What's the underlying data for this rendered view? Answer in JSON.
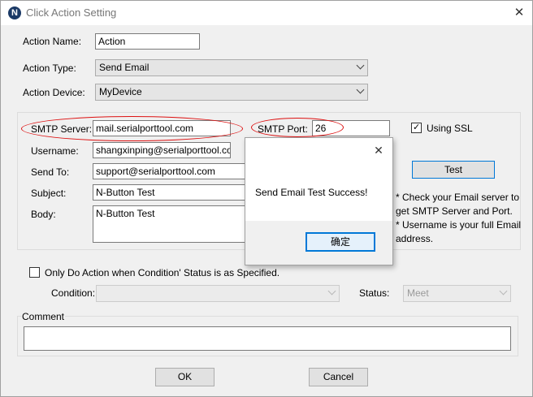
{
  "window": {
    "title": "Click Action Setting",
    "app_icon_letter": "N",
    "close_glyph": "✕"
  },
  "action": {
    "name_label": "Action Name:",
    "name_value": "Action",
    "type_label": "Action Type:",
    "type_value": "Send Email",
    "device_label": "Action Device:",
    "device_value": "MyDevice"
  },
  "email": {
    "smtp_server_label": "SMTP Server:",
    "smtp_server_value": "mail.serialporttool.com",
    "smtp_port_label": "SMTP Port:",
    "smtp_port_value": "26",
    "ssl_label": "Using SSL",
    "ssl_checked": true,
    "check_glyph": "✓",
    "username_label": "Username:",
    "username_value": "shangxinping@serialporttool.com",
    "sendto_label": "Send To:",
    "sendto_value": "support@serialporttool.com",
    "subject_label": "Subject:",
    "subject_value": "N-Button Test",
    "body_label": "Body:",
    "body_value": "N-Button Test",
    "test_button": "Test",
    "notes": [
      "* Check your Email server to",
      "get SMTP Server and Port.",
      "* Username is your full Email",
      "address."
    ]
  },
  "condition": {
    "only_label": "Only Do Action when Condition' Status is as Specified.",
    "condition_label": "Condition:",
    "condition_value": "",
    "status_label": "Status:",
    "status_value": "Meet"
  },
  "comment": {
    "label": "Comment",
    "value": ""
  },
  "buttons": {
    "ok": "OK",
    "cancel": "Cancel"
  },
  "dialog": {
    "message": "Send Email Test Success!",
    "ok_button": "确定",
    "close_glyph": "✕"
  },
  "colors": {
    "highlight": "#dd1111",
    "accent": "#0078d7",
    "app_icon_bg": "#1b3a66"
  }
}
